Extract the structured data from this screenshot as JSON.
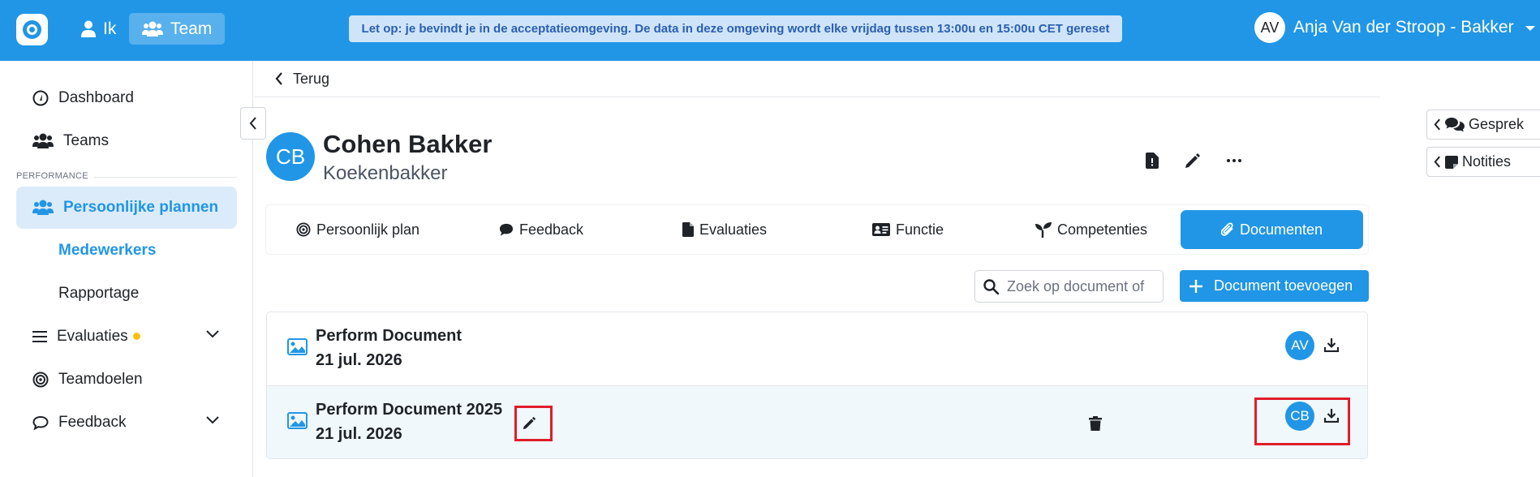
{
  "topbar": {
    "nav": [
      {
        "label": "Ik",
        "icon": "user-icon"
      },
      {
        "label": "Team",
        "icon": "users-icon"
      }
    ],
    "banner": "Let op: je bevindt je in de acceptatieomgeving. De data in deze omgeving wordt elke vrijdag tussen 13:00u en 15:00u CET gereset",
    "user": {
      "initials": "AV",
      "name": "Anja Van der Stroop - Bakker"
    },
    "accent": "#2196e6"
  },
  "sidebar": {
    "items": [
      {
        "label": "Dashboard",
        "icon": "gauge-icon"
      },
      {
        "label": "Teams",
        "icon": "users-icon"
      }
    ],
    "section_label": "PERFORMANCE",
    "active_item": "Persoonlijke plannen",
    "sub_items": [
      "Medewerkers",
      "Rapportage"
    ],
    "items_after": [
      {
        "label": "Evaluaties",
        "icon": "list-icon"
      },
      {
        "label": "Teamdoelen",
        "icon": "target-icon"
      },
      {
        "label": "Feedback",
        "icon": "comment-icon"
      }
    ]
  },
  "main": {
    "back_label": "Terug",
    "person": {
      "initials": "CB",
      "name": "Cohen Bakker",
      "role": "Koekenbakker"
    },
    "tabs": [
      {
        "label": "Persoonlijk plan",
        "icon": "target-icon"
      },
      {
        "label": "Feedback",
        "icon": "comment-icon"
      },
      {
        "label": "Evaluaties",
        "icon": "file-icon"
      },
      {
        "label": "Functie",
        "icon": "id-card-icon"
      },
      {
        "label": "Competenties",
        "icon": "seedling-icon"
      },
      {
        "label": "Documenten",
        "icon": "paperclip-icon",
        "active": true
      }
    ],
    "search_placeholder": "Zoek op document of",
    "add_button": "Document toevoegen",
    "documents": [
      {
        "title": "Perform Document",
        "date": "21 jul. 2026",
        "owner_initials": "AV"
      },
      {
        "title": "Perform Document 2025",
        "date": "21 jul. 2026",
        "owner_initials": "CB"
      }
    ]
  },
  "right_panel": {
    "tabs": [
      "Gesprek",
      "Notities"
    ]
  }
}
